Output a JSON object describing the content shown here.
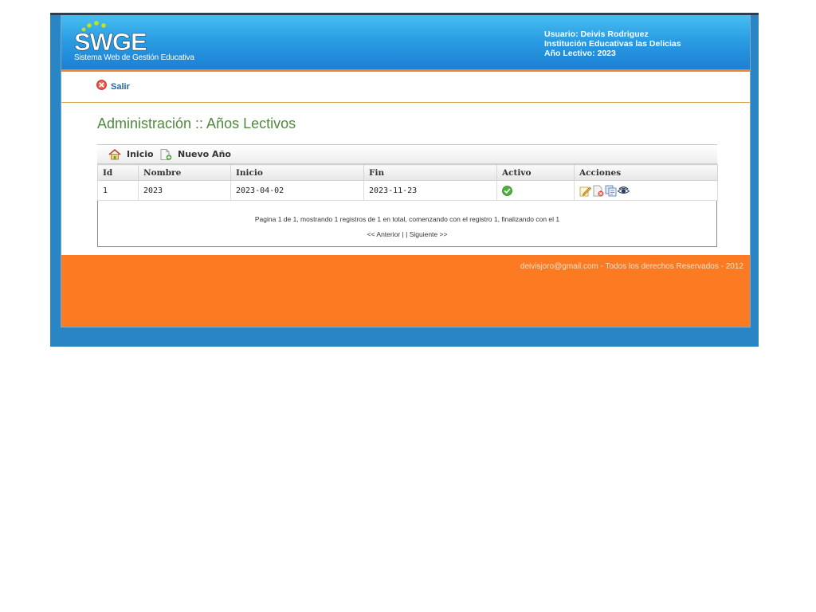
{
  "header": {
    "logo_text": "SWGE",
    "tagline": "Sistema Web de Gestión Educativa",
    "user_line": "Usuario: Deivis Rodriguez",
    "institution_line": "Institución Educativas las Delicias",
    "year_line": "Año Lectivo: 2023"
  },
  "logout": {
    "label": "Salir",
    "icon": "close-circle-icon"
  },
  "page_title": "Administración :: Años Lectivos",
  "toolbar": {
    "home_label": "Inicio",
    "new_label": "Nuevo Año"
  },
  "table": {
    "columns": [
      "Id",
      "Nombre",
      "Inicio",
      "Fin",
      "Activo",
      "Acciones"
    ],
    "rows": [
      {
        "id": "1",
        "name": "2023",
        "start": "2023-04-02",
        "end": "2023-11-23",
        "active": true
      }
    ],
    "action_icons": [
      "edit-icon",
      "delete-icon",
      "copy-icon",
      "view-icon"
    ]
  },
  "pager": {
    "info": "Pagina 1 de 1, mostrando 1 registros de 1 en total, comenzando con el registro 1, finalizando con el 1",
    "prev": "<< Anterior",
    "separator": " | | ",
    "next": "Siguiente >>"
  },
  "footer": {
    "text": "deivisjoro@gmail.com - Todos los derechos Reservados - 2012"
  },
  "colors": {
    "frame_blue": "#2a85c4",
    "header_blue": "#2a9de3",
    "orange": "#fc7a22",
    "title_green": "#4f8a3c",
    "link_blue": "#2466a8"
  }
}
